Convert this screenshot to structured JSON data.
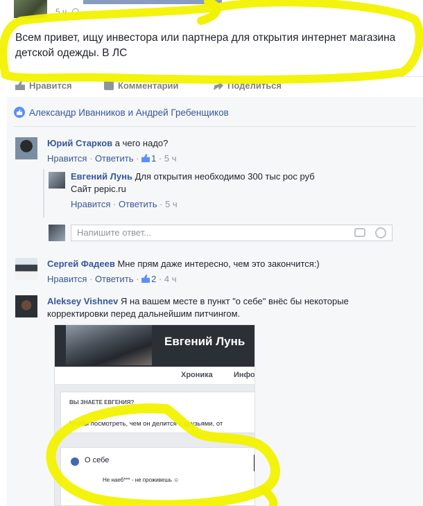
{
  "post": {
    "time": "5 ч",
    "text": "Всем привет, ищу инвестора или партнера для открытия интернет магазина детской одежды. В ЛС"
  },
  "actions": {
    "like": "Нравится",
    "comment": "Комментарий",
    "share": "Поделиться"
  },
  "likers": "Александр Иванников и Андрей Гребенщиков",
  "comments": [
    {
      "name": "Юрий Старков",
      "text": "а чего надо?",
      "like_label": "Нравится",
      "reply_label": "Ответить",
      "likes": "1",
      "time": "5 ч"
    },
    {
      "name": "Евгений Лунь",
      "text": "Для открытия необходимо 300 тыс рос руб",
      "text2": "Сайт pepic.ru",
      "like_label": "Нравится",
      "reply_label": "Ответить",
      "time": "5 ч"
    },
    {
      "name": "Сергей Фадеев",
      "text": "Мне прям даже интересно, чем это закончится:)",
      "like_label": "Нравится",
      "reply_label": "Ответить",
      "likes": "2",
      "time": "4 ч"
    },
    {
      "name": "Aleksey Vishnev",
      "text": "Я на вашем месте в пункт \"о себе\" внёс бы некоторые корректировки перед дальнейшим питчингом."
    }
  ],
  "reply_input": {
    "placeholder": "Напишите ответ..."
  },
  "embed": {
    "profile_name": "Евгений Лунь",
    "tab_timeline": "Хроника",
    "tab_info": "Инфо",
    "know_heading": "ВЫ ЗНАЕТЕ ЕВГЕНИЯ?",
    "friends_text": "Чтобы посмотреть, чем он делится с друзьями, от",
    "about_title": "О себе",
    "about_text": "Не наеб*** - не проживешь ☺"
  },
  "colors": {
    "link": "#365899",
    "meta": "#90949c",
    "highlighter": "#f2f200"
  },
  "icons": [
    "globe-icon",
    "like-icon",
    "comment-icon",
    "share-icon",
    "like-badge-icon",
    "camera-icon",
    "smile-icon",
    "info-icon"
  ]
}
